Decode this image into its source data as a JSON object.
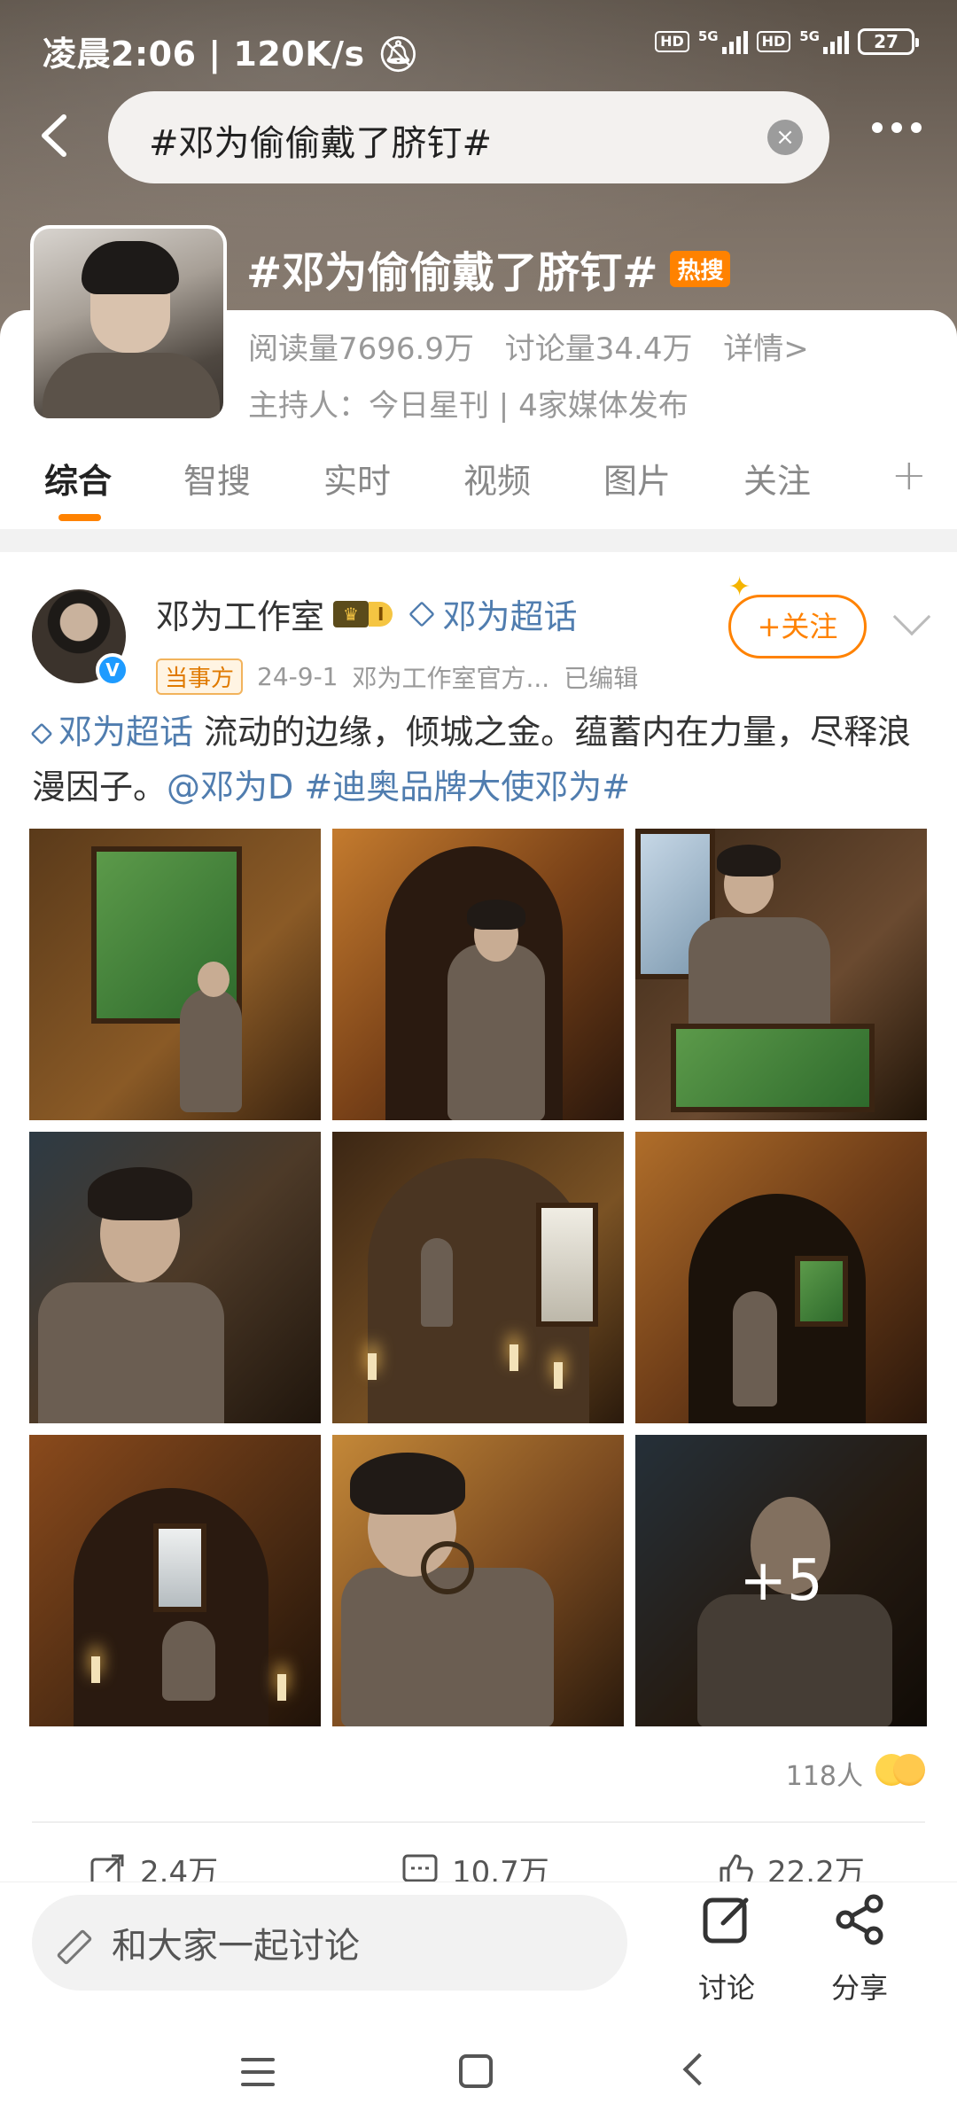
{
  "status_bar": {
    "time": "凌晨2:06",
    "speed": "120K/s",
    "hd_label": "HD",
    "network": "5G",
    "battery": "27"
  },
  "search": {
    "query": "#邓为偷偷戴了脐钉#"
  },
  "topic": {
    "title": "#邓为偷偷戴了脐钉#",
    "hot_badge": "热搜",
    "reads": "阅读量7696.9万",
    "discussions": "讨论量34.4万",
    "details": "详情>",
    "host": "主持人：今日星刊 | 4家媒体发布"
  },
  "tabs": [
    "综合",
    "智搜",
    "实时",
    "视频",
    "图片",
    "关注"
  ],
  "post": {
    "author": "邓为工作室",
    "member_level": "I",
    "super_topic": "邓为超话",
    "party_tag": "当事方",
    "date": "24-9-1",
    "source": "邓为工作室官方...",
    "edited": "已编辑",
    "follow_label": "+关注",
    "text_link": "邓为超话",
    "text_body": " 流动的边缘，倾城之金。蕴蓄内在力量，尽释浪漫因子。",
    "text_mention": "@邓为D",
    "text_hashtag": "#迪奥品牌大使邓为#",
    "more_photos": "+5",
    "likers_count": "118人",
    "reposts": "2.4万",
    "comments": "10.7万",
    "likes": "22.2万"
  },
  "bottom_bar": {
    "input_placeholder": "和大家一起讨论",
    "discuss_label": "讨论",
    "share_label": "分享"
  },
  "colors": {
    "accent_orange": "#ff8200",
    "link_blue": "#507daf"
  }
}
